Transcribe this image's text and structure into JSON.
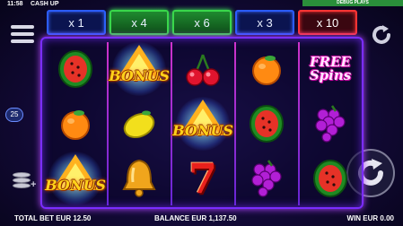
{
  "status_bar": {
    "time": "11:58",
    "game_title": "CASH UP",
    "debug_label": "DEBUG PLAYS"
  },
  "multipliers": [
    {
      "label": "x 1",
      "state": "blue"
    },
    {
      "label": "x 4",
      "state": "lit"
    },
    {
      "label": "x 6",
      "state": "lit"
    },
    {
      "label": "x 3",
      "state": "blue"
    },
    {
      "label": "x 10",
      "state": "hot"
    }
  ],
  "lines_count": "25",
  "reels": [
    [
      "watermelon",
      "orange",
      "bonus"
    ],
    [
      "bonus",
      "lemon",
      "bell"
    ],
    [
      "cherry",
      "bonus",
      "seven"
    ],
    [
      "orange",
      "watermelon",
      "grapes"
    ],
    [
      "free_spins",
      "grapes",
      "watermelon"
    ]
  ],
  "symbol_text": {
    "bonus": "BONUS",
    "free_spins_line1": "FREE",
    "free_spins_line2": "Spins",
    "seven": "7"
  },
  "bottom_bar": {
    "total_bet": "TOTAL BET EUR 12.50",
    "balance": "BALANCE EUR 1,137.50",
    "win": "WIN EUR 0.00"
  },
  "colors": {
    "frame": "#7b2dff",
    "multiplier_blue": "#2b5cff",
    "multiplier_lit": "#39d74b",
    "multiplier_hot": "#ff3434",
    "bonus_text": "#ffd21a",
    "free_spins_text": "#ff2ad6"
  }
}
